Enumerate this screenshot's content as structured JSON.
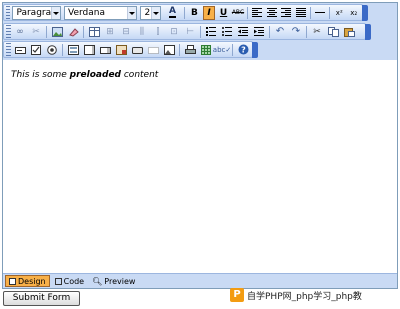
{
  "toolbar": {
    "paragraph_format": "Paragraph",
    "font_name": "Verdana",
    "font_size": "2",
    "bold_label": "B",
    "italic_label": "I",
    "underline_label": "U",
    "strike_label": "ABC",
    "superscript_label": "x²",
    "subscript_label": "x₂"
  },
  "editor": {
    "content_before": "This is some ",
    "content_bold": "preloaded",
    "content_after": " content"
  },
  "modes": {
    "design": "Design",
    "code": "Code",
    "preview": "Preview"
  },
  "submit_label": "Submit Form",
  "watermark": {
    "logo": "P",
    "text": "自学PHP网_php学习_php教"
  },
  "colors": {
    "toolbar_bg": "#c9daf4",
    "active_button": "#f8b048",
    "border": "#7f9db9"
  }
}
